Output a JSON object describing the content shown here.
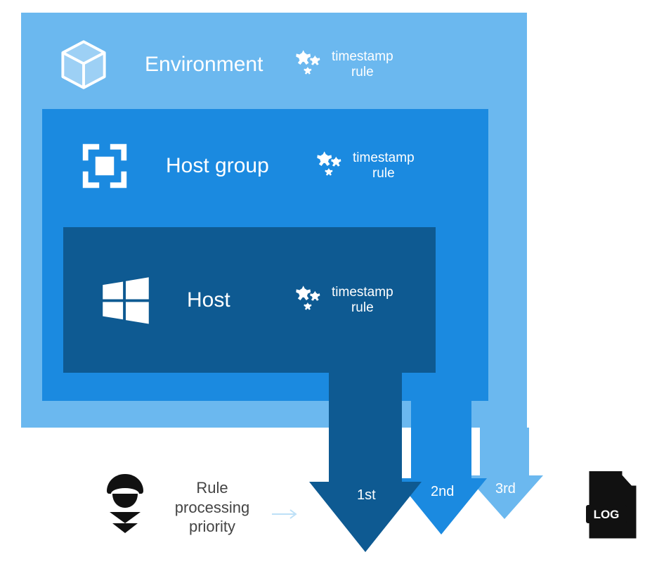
{
  "levels": {
    "environment": {
      "label": "Environment",
      "ts_label1": "timestamp",
      "ts_label2": "rule"
    },
    "hostgroup": {
      "label": "Host group",
      "ts_label1": "timestamp",
      "ts_label2": "rule"
    },
    "host": {
      "label": "Host",
      "ts_label1": "timestamp",
      "ts_label2": "rule"
    }
  },
  "arrows": {
    "first": "1st",
    "second": "2nd",
    "third": "3rd"
  },
  "priority": {
    "line1": "Rule",
    "line2": "processing",
    "line3": "priority"
  },
  "icons": {
    "environment": "cube-icon",
    "hostgroup": "frame-icon",
    "host": "windows-icon",
    "agent": "agent-icon",
    "log": "log-icon"
  },
  "colors": {
    "environment": "#6bb8ef",
    "hostgroup": "#1b8ae0",
    "host": "#0e5a92"
  }
}
